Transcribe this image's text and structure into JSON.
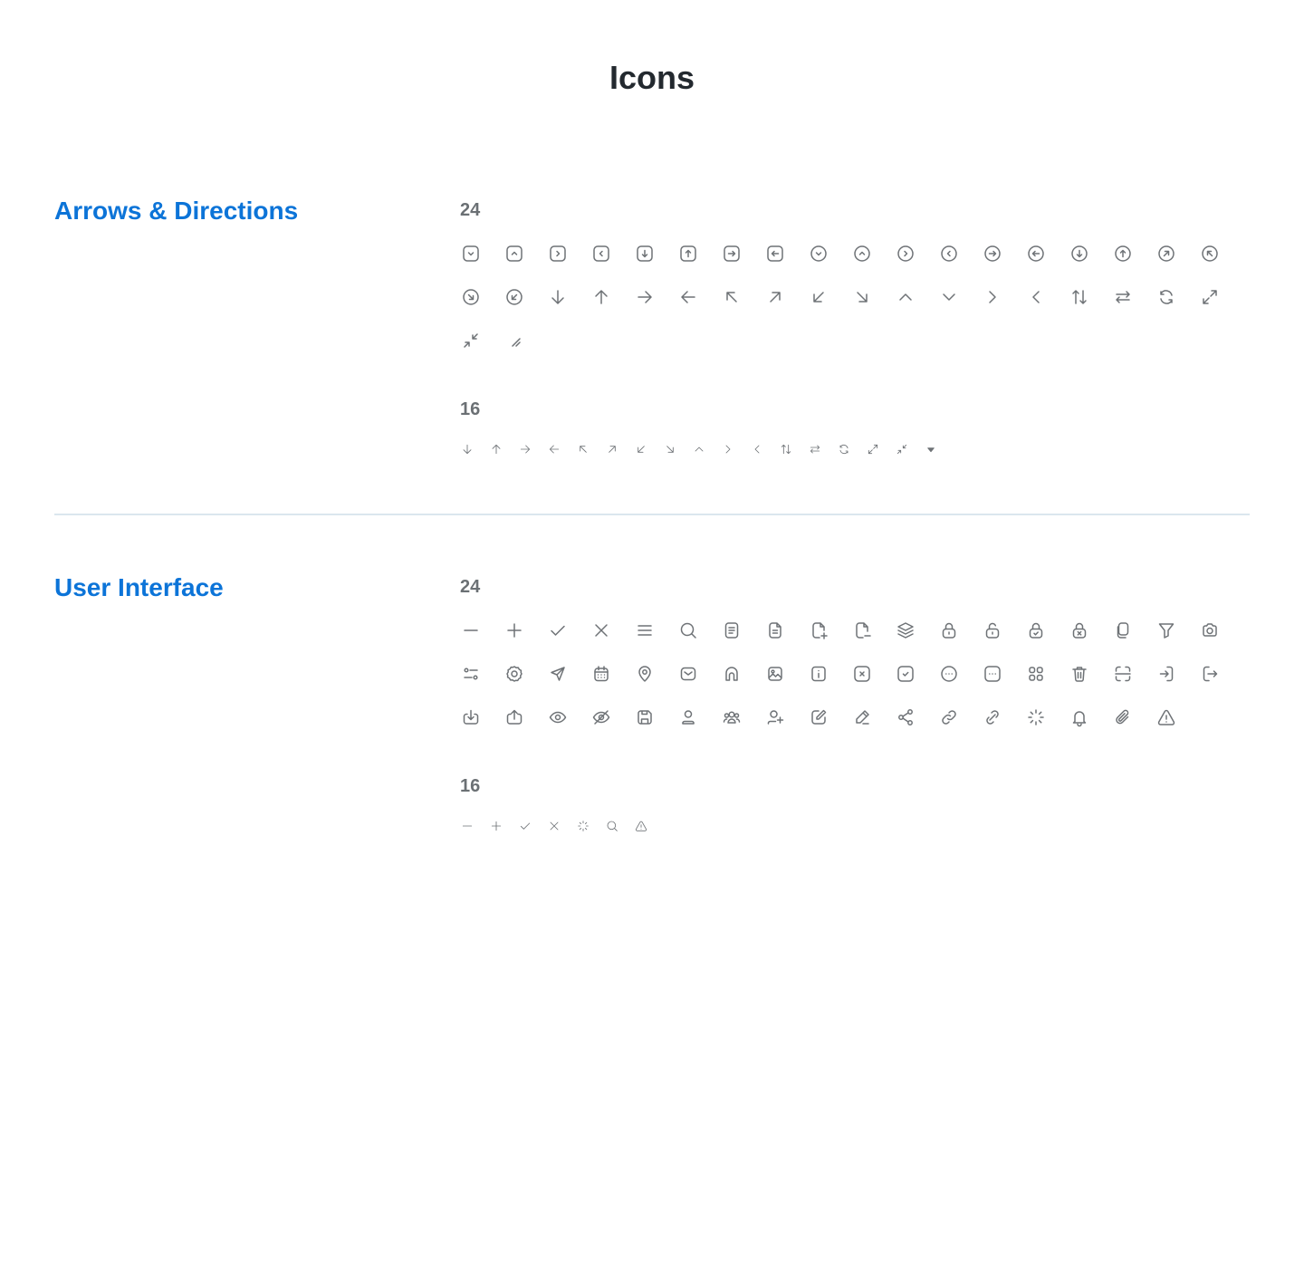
{
  "page": {
    "title": "Icons"
  },
  "colors": {
    "accent": "#0c74d8",
    "icon": "#6e7276",
    "heading": "#23292f",
    "divider": "#dbe6ee"
  },
  "sections": [
    {
      "title": "Arrows & Directions",
      "groups": [
        {
          "size": "24",
          "icons": [
            "square-chevron-down",
            "square-chevron-up",
            "square-chevron-right",
            "square-chevron-left",
            "square-arrow-down",
            "square-arrow-up",
            "square-arrow-right",
            "square-arrow-left",
            "circle-chevron-down",
            "circle-chevron-up",
            "circle-chevron-right",
            "circle-chevron-left",
            "circle-arrow-right",
            "circle-arrow-left",
            "circle-arrow-down",
            "circle-arrow-up",
            "circle-arrow-up-right",
            "circle-arrow-up-left",
            "circle-arrow-down-right",
            "circle-arrow-down-left",
            "arrow-down",
            "arrow-up",
            "arrow-right",
            "arrow-left",
            "arrow-up-left",
            "arrow-up-right",
            "arrow-down-left",
            "arrow-down-right",
            "chevron-up",
            "chevron-down",
            "chevron-right",
            "chevron-left",
            "arrows-up-down",
            "arrows-left-right",
            "refresh",
            "expand",
            "collapse",
            "resize-handle"
          ]
        },
        {
          "size": "16",
          "icons": [
            "arrow-down",
            "arrow-up",
            "arrow-right",
            "arrow-left",
            "arrow-up-left",
            "arrow-up-right",
            "arrow-down-left",
            "arrow-down-right",
            "chevron-up",
            "chevron-right",
            "chevron-left",
            "arrows-up-down",
            "arrows-left-right",
            "refresh",
            "expand",
            "collapse",
            "caret-down"
          ]
        }
      ]
    },
    {
      "title": "User Interface",
      "groups": [
        {
          "size": "24",
          "icons": [
            "minus",
            "plus",
            "check",
            "close",
            "menu",
            "search",
            "document",
            "document-text",
            "document-add",
            "document-remove",
            "layers",
            "lock",
            "unlock",
            "lock-check",
            "lock-x",
            "copy",
            "filter",
            "camera",
            "sliders",
            "gear",
            "send",
            "calendar",
            "location-pin",
            "mail",
            "home",
            "image",
            "info-square",
            "x-square",
            "check-square",
            "more-circle",
            "more-square",
            "grid",
            "trash",
            "scan",
            "login",
            "logout",
            "download",
            "upload",
            "eye",
            "eye-off",
            "save",
            "user",
            "users",
            "user-add",
            "edit",
            "pencil",
            "share",
            "link",
            "link-alt",
            "loading",
            "bell",
            "paperclip",
            "warning"
          ]
        },
        {
          "size": "16",
          "icons": [
            "minus",
            "plus",
            "check",
            "close",
            "loading",
            "search",
            "warning"
          ]
        }
      ]
    }
  ]
}
